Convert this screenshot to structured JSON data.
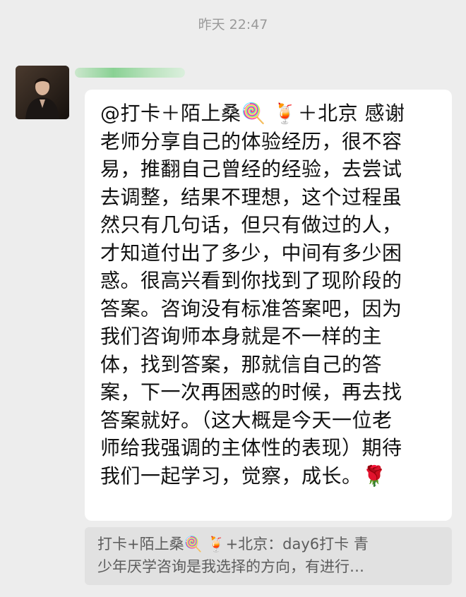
{
  "header": {
    "timestamp": "昨天 22:47"
  },
  "message": {
    "text": "@打卡＋陌上桑🍭 🍹＋北京 感谢\n老师分享自己的体验经历，很不容\n易，推翻自己曾经的经验，去尝试\n去调整，结果不理想，这个过程虽\n然只有几句话，但只有做过的人，\n才知道付出了多少，中间有多少困\n惑。很高兴看到你找到了现阶段的\n答案。咨询没有标准答案吧，因为\n我们咨询师本身就是不一样的主\n体，找到答案，那就信自己的答\n案，下一次再困惑的时候，再去找\n答案就好。（这大概是今天一位老\n师给我强调的主体性的表现）期待\n我们一起学习，觉察，成长。🌹"
  },
  "quote": {
    "text": "打卡+陌上桑🍭 🍹+北京：day6打卡 青\n少年厌学咨询是我选择的方向，有进行…"
  },
  "colors": {
    "background": "#ededed",
    "bubble": "#ffffff",
    "quote_bg": "#e1e1e1",
    "timestamp": "#9a9a9a"
  }
}
